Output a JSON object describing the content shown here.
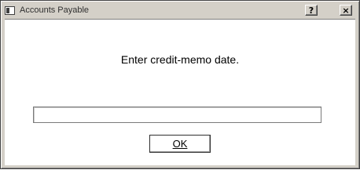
{
  "window": {
    "title": "Accounts Payable",
    "help_label": "?",
    "close_label": "×"
  },
  "dialog": {
    "prompt": "Enter credit-memo date.",
    "date_value": "",
    "ok_label": "OK"
  },
  "icons": {
    "app": "app-window-icon",
    "help": "help-icon",
    "close": "close-icon"
  },
  "colors": {
    "chrome": "#d4d0c8",
    "client_background": "#ffffff",
    "text": "#000000"
  }
}
